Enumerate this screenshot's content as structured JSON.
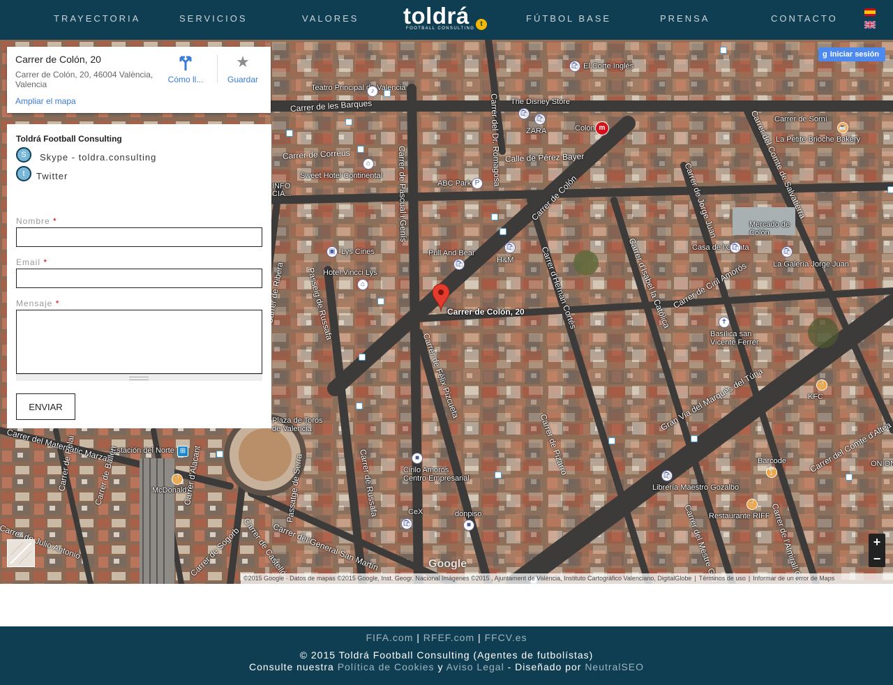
{
  "nav": {
    "left": [
      "TRAYECTORIA",
      "SERVICIOS",
      "VALORES"
    ],
    "right": [
      "FÚTBOL BASE",
      "PRENSA",
      "CONTACTO"
    ],
    "logo_word": "toldrá",
    "logo_sub": "FOOTBALL CONSULTING",
    "logo_badge": "t",
    "flags": [
      "flag-es-icon",
      "flag-uk-icon"
    ]
  },
  "map": {
    "place_title": "Carrer de Colón, 20",
    "place_address": "Carrer de Colón, 20, 46004 València, Valencia",
    "enlarge_link": "Ampliar el mapa",
    "directions_label": "Cómo ll...",
    "save_label": "Guardar",
    "signin_label": "Iniciar sesión",
    "marker_label": "Carrer de Colón, 20",
    "watermark": "Google",
    "attribution": [
      "©2015 Google · Datos de mapas ©2015 Google, Inst. Geogr. Nacional Imágenes ©2015 , Ajuntament de València, Instituto Cartográfico Valenciano, DigitalGlobe",
      "Términos de uso",
      "Informar de un error de Maps"
    ],
    "labels": [
      "El Corte Inglés",
      "Teatro Principal de Valencia",
      "The Disney Store",
      "ZARA",
      "Colón",
      "Carrer de Sorní",
      "La Petite Brioche Bakery",
      "Sweet Hotel Continental",
      "ABC Park",
      "Mercado de Colón",
      "Casa de l'Orxata",
      "La Galería Jorge Juan",
      "Lys Cines",
      "Pull And Bear",
      "H&M",
      "Hotel Vincci Lys",
      "Basílica san Vicente Ferrer",
      "KFC",
      "Plaza de Toros de Valencia",
      "Estación del Norte",
      "McDonald's",
      "Cirilo Amorós Centro Empresarial",
      "Barcode",
      "Librería Maestro Gozalbo",
      "Restaurante RIFF",
      "CeX",
      "donpiso",
      "ONION",
      "INFO CIA..."
    ],
    "streets": [
      "Carrer de les Barques",
      "Carrer de Correus",
      "Calle de Pérez Bayer",
      "Carrer de Colón",
      "Carrer del Dr. Romagosa",
      "Carrer de Pascual i Genís",
      "Passeig de Russafa",
      "Carrer de Ribera",
      "Carrer de Fèlix Pizcueta",
      "Carrer d'Hernán Cortés",
      "Carrer d'Isabel la Católica",
      "Carrer de Jorge Juan",
      "Carrer de Ciril Amorós",
      "Gran Via del Marquès del Túria",
      "Carrer del Comte de Salvatierra",
      "Carrer del Matemàtic Marzal",
      "Carrer de Bailén",
      "Carrer de Pelai",
      "Carrer d'Alacant",
      "Carrer de Sogorb",
      "Carrer de Castelló",
      "Passatge de Serra",
      "Carrer de Russafa",
      "Carrer del General San Martín",
      "Carrer de Pizarro",
      "Carrer del Comte d'Altea",
      "Carrer de Julio Antonio",
      "Carrer del Mestre Gozalbo",
      "Carrer de l'Almirall Cadarso"
    ]
  },
  "contact": {
    "title": "Toldrá Football Consulting",
    "skype": "Skype - toldra.consulting",
    "twitter": "Twitter",
    "name_label": "Nombre",
    "email_label": "Email",
    "message_label": "Mensaje",
    "required_mark": "*",
    "send_label": "ENVIAR"
  },
  "footer": {
    "links": [
      "FIFA.com",
      "RFEF.com",
      "FFCV.es"
    ],
    "separator": "|",
    "copyright": "© 2015 Toldrá Football Consulting (Agentes de futbolístas)",
    "legal_prefix": "Consulte nuestra",
    "cookies": "Política de Cookies",
    "and": "y",
    "aviso": "Aviso Legal",
    "designed_prefix": "- Diseñado por",
    "designer": "NeutralSEO"
  },
  "colors": {
    "header_bg": "#0f3e52",
    "link_blue": "#3a7bd5",
    "required": "#cc0000"
  }
}
